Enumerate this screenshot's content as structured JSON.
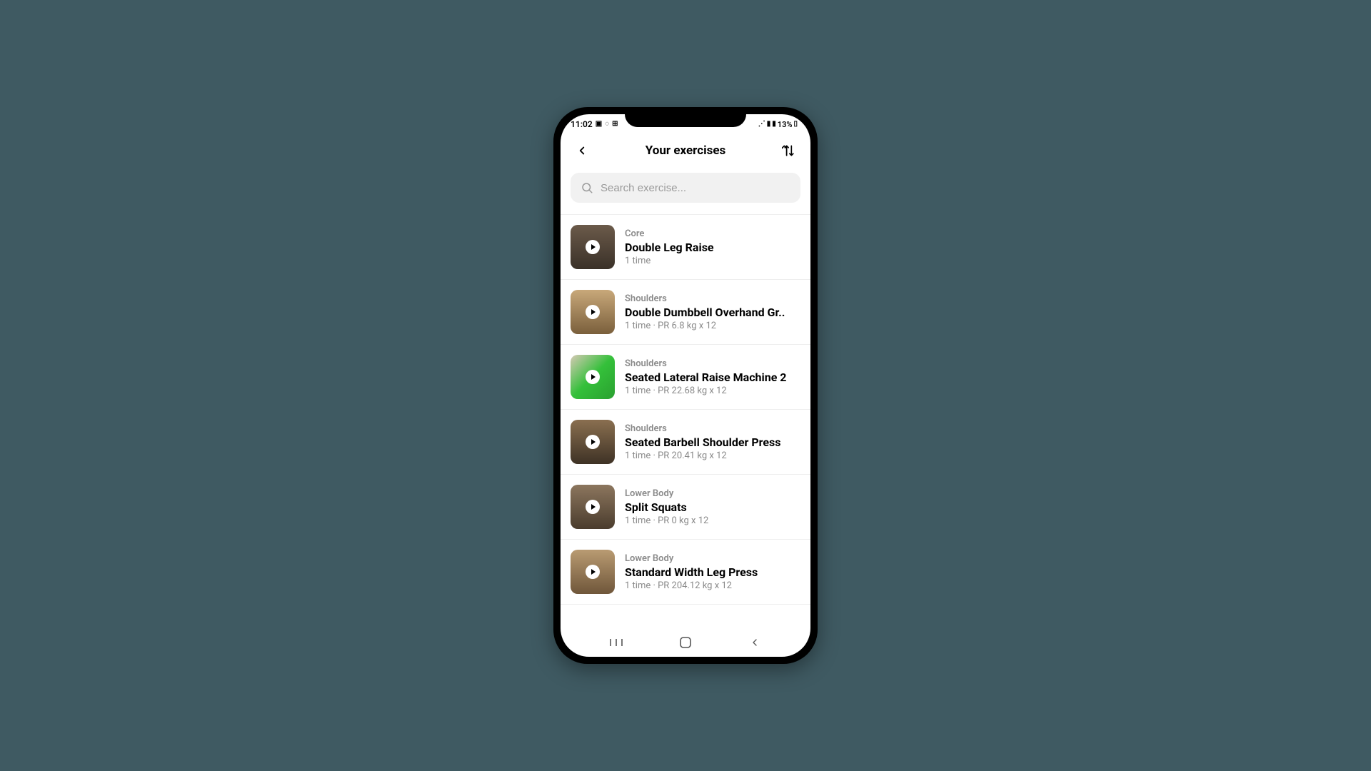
{
  "statusbar": {
    "time": "11:02",
    "battery": "13%"
  },
  "header": {
    "title": "Your exercises"
  },
  "search": {
    "placeholder": "Search exercise..."
  },
  "exercises": [
    {
      "category": "Core",
      "name": "Double Leg Raise",
      "sub": "1 time"
    },
    {
      "category": "Shoulders",
      "name": "Double Dumbbell Overhand Gr..",
      "sub": "1 time · PR 6.8 kg x 12"
    },
    {
      "category": "Shoulders",
      "name": "Seated Lateral Raise Machine 2",
      "sub": "1 time · PR 22.68 kg x 12"
    },
    {
      "category": "Shoulders",
      "name": "Seated Barbell Shoulder Press",
      "sub": "1 time · PR 20.41 kg x 12"
    },
    {
      "category": "Lower Body",
      "name": "Split Squats",
      "sub": "1 time · PR 0 kg x 12"
    },
    {
      "category": "Lower Body",
      "name": "Standard Width Leg Press",
      "sub": "1 time · PR 204.12 kg x 12"
    }
  ]
}
